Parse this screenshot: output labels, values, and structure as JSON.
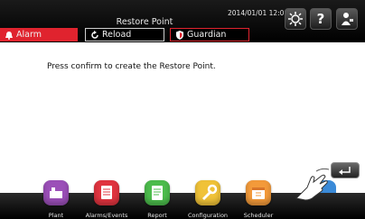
{
  "header": {
    "title": "Restore Point",
    "datetime": "2014/01/01  12:00"
  },
  "tabs": [
    {
      "label": "Alarm"
    },
    {
      "label": "Reload"
    },
    {
      "label": "Guardian"
    }
  ],
  "content": {
    "message": "Press confirm to create the Restore Point."
  },
  "nav": [
    {
      "label": "Plant",
      "icon": "plant-icon",
      "color": "#9b4fb8"
    },
    {
      "label": "Alarms/Events",
      "icon": "alarms-events-icon",
      "color": "#e0343f"
    },
    {
      "label": "Report",
      "icon": "report-icon",
      "color": "#4cbc4c"
    },
    {
      "label": "Configuration",
      "icon": "configuration-icon",
      "color": "#f0c238"
    },
    {
      "label": "Scheduler",
      "icon": "scheduler-icon",
      "color": "#f39a3a"
    }
  ],
  "colors": {
    "alarm_red": "#e0232e",
    "header_bg": "#000000"
  }
}
